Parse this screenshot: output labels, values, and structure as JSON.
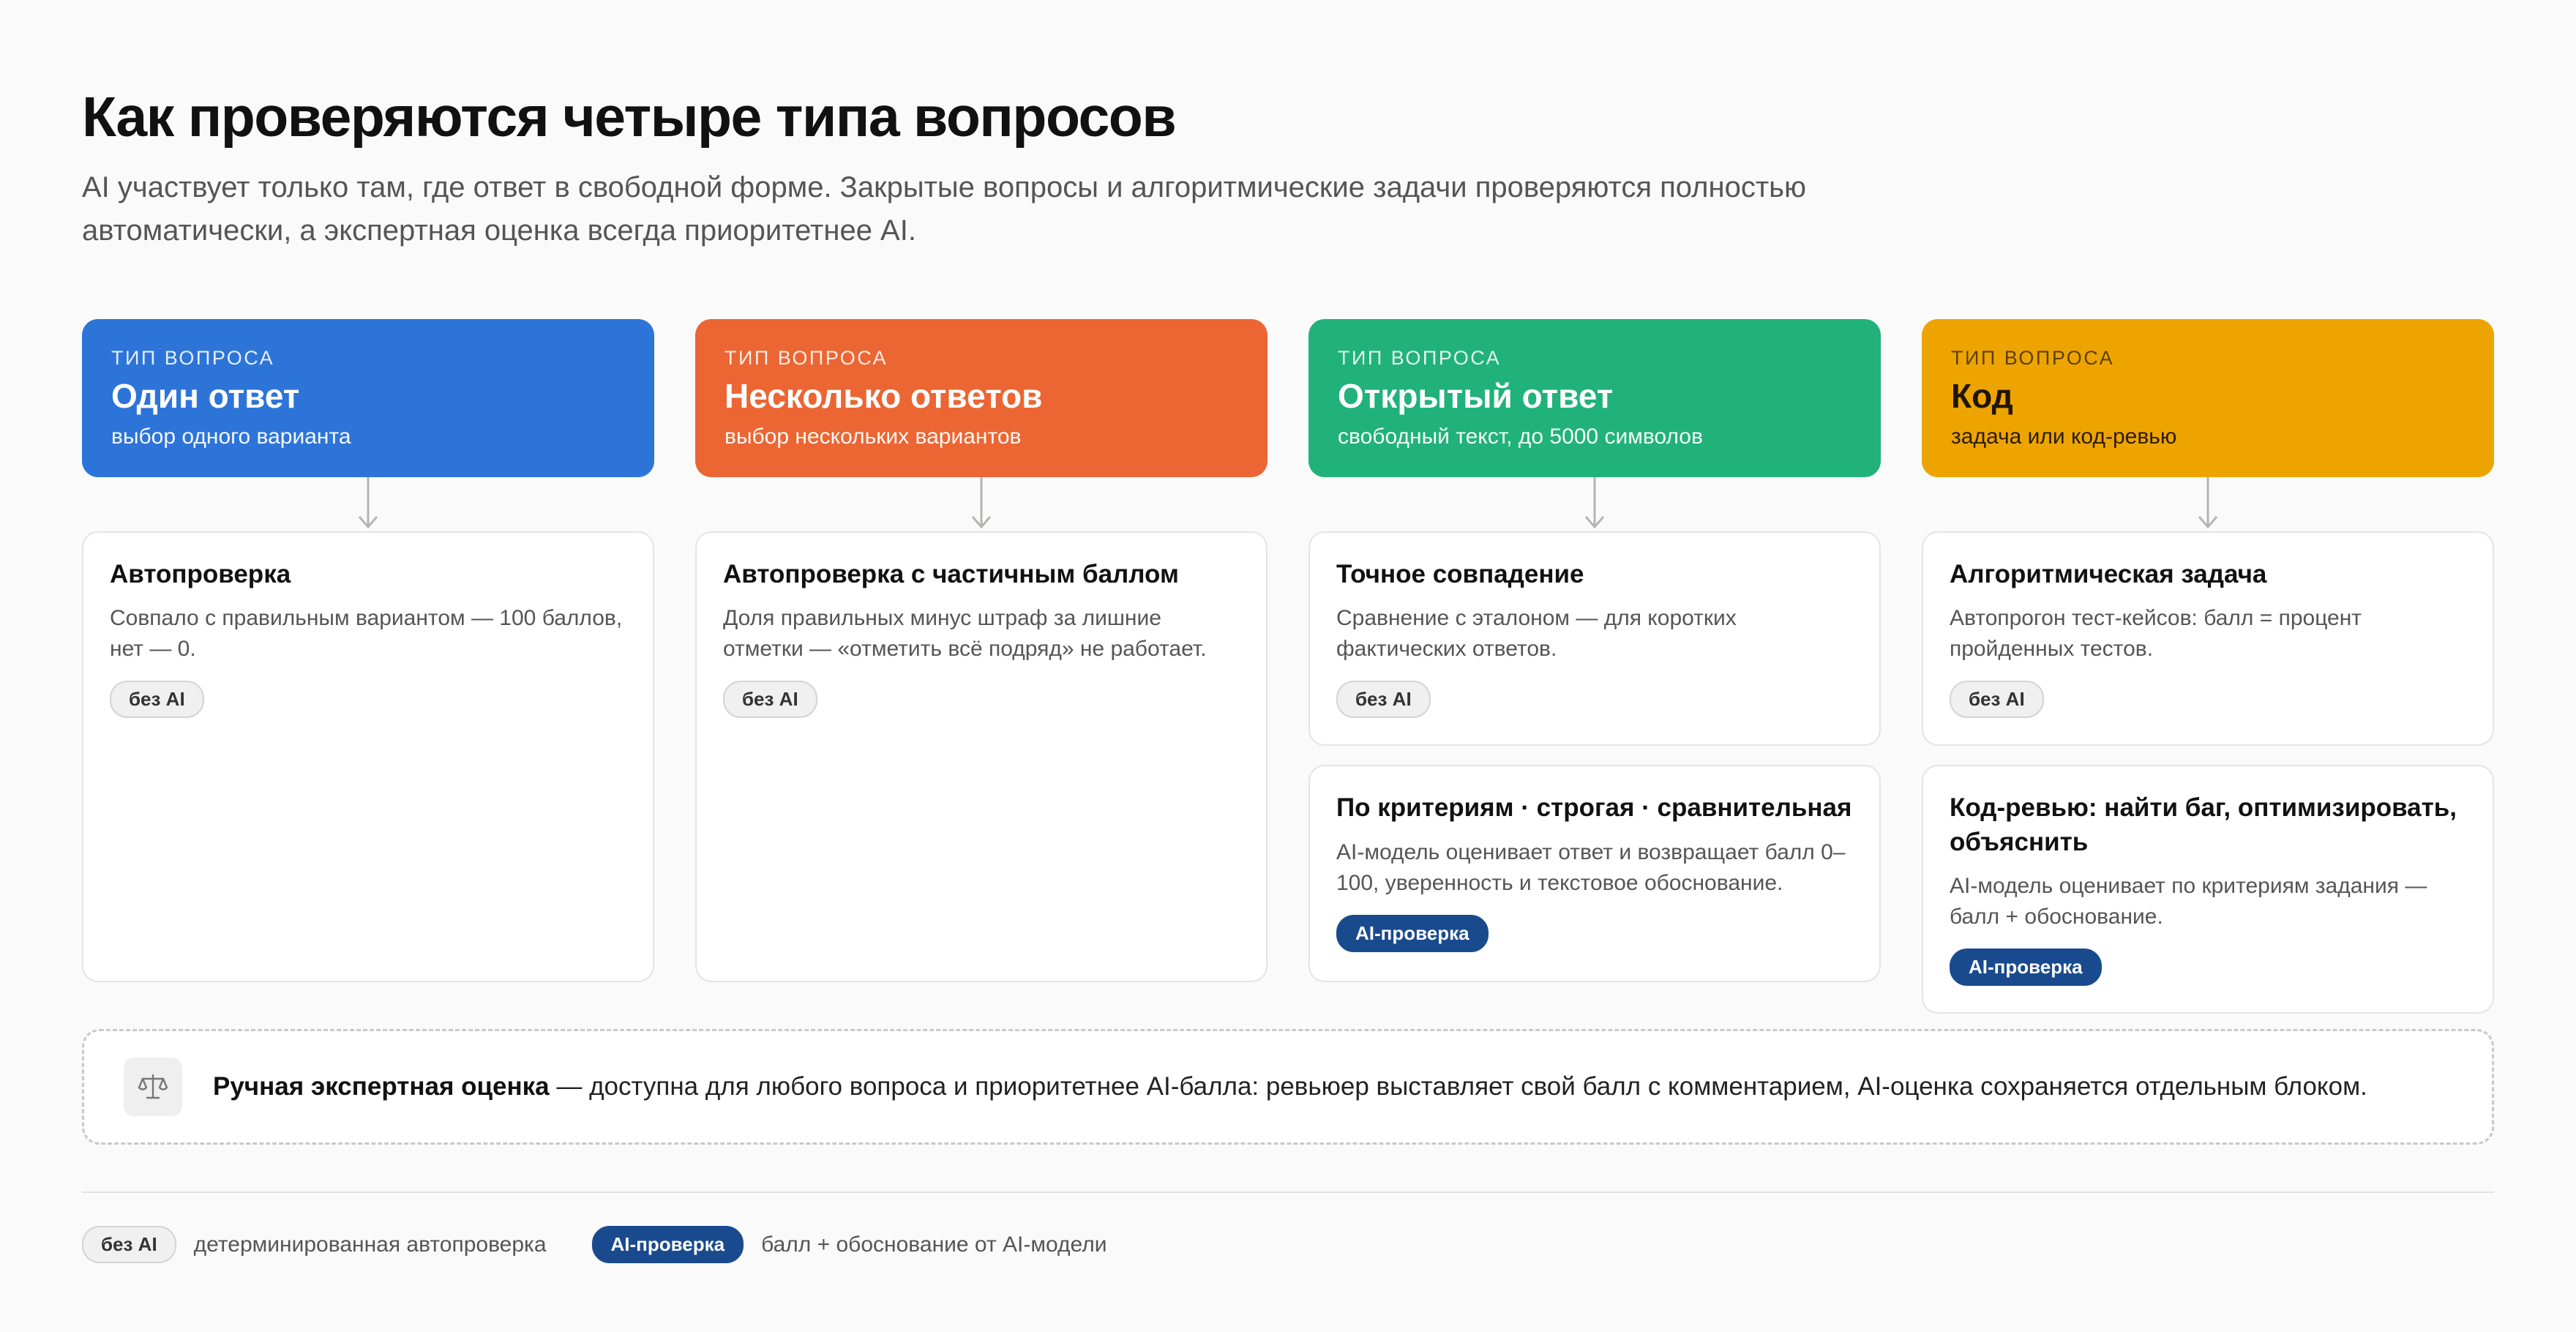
{
  "title": "Как проверяются четыре типа вопросов",
  "subtitle": "AI участвует только там, где ответ в свободной форме. Закрытые вопросы и алгоритмические задачи проверяются полностью автоматически, а экспертная оценка всегда приоритетнее AI.",
  "colors": {
    "single": "#2d74d9",
    "multiple": "#eb6633",
    "open": "#20b27a",
    "code": "#eea400",
    "ai_badge": "#1a4a8e"
  },
  "columns": [
    {
      "kicker": "ТИП ВОПРОСА",
      "name": "Один ответ",
      "desc": "выбор одного варианта",
      "cards": [
        {
          "title": "Автопроверка",
          "text": "Совпало с правильным вариантом — 100 баллов, нет — 0.",
          "badge": "без AI"
        }
      ]
    },
    {
      "kicker": "ТИП ВОПРОСА",
      "name": "Несколько ответов",
      "desc": "выбор нескольких вариантов",
      "cards": [
        {
          "title": "Автопроверка с частичным баллом",
          "text": "Доля правильных минус штраф за лишние отметки — «отметить всё подряд» не работает.",
          "badge": "без AI"
        }
      ]
    },
    {
      "kicker": "ТИП ВОПРОСА",
      "name": "Открытый ответ",
      "desc": "свободный текст, до 5000 символов",
      "cards": [
        {
          "title": "Точное совпадение",
          "text": "Сравнение с эталоном — для коротких фактических ответов.",
          "badge": "без AI"
        },
        {
          "title": "По критериям · строгая · сравнительная",
          "text": "AI-модель оценивает ответ и возвращает балл 0–100, уверенность и текстовое обоснование.",
          "badge": "AI-проверка"
        }
      ]
    },
    {
      "kicker": "ТИП ВОПРОСА",
      "name": "Код",
      "desc": "задача или код-ревью",
      "cards": [
        {
          "title": "Алгоритмическая задача",
          "text": "Автопрогон тест-кейсов: балл = процент пройденных тестов.",
          "badge": "без AI"
        },
        {
          "title": "Код-ревью: найти баг, оптимизировать, объяснить",
          "text": "AI-модель оценивает по критериям задания — балл + обоснование.",
          "badge": "AI-проверка"
        }
      ]
    }
  ],
  "manual": {
    "icon": "scales-icon",
    "bold": "Ручная экспертная оценка",
    "text": " — доступна для любого вопроса и приоритетнее AI-балла: ревьюер выставляет свой балл с комментарием, AI-оценка сохраняется отдельным блоком."
  },
  "legend": {
    "noai_badge": "без AI",
    "noai_text": "детерминированная автопроверка",
    "ai_badge": "AI-проверка",
    "ai_text": "балл + обоснование от AI-модели"
  }
}
